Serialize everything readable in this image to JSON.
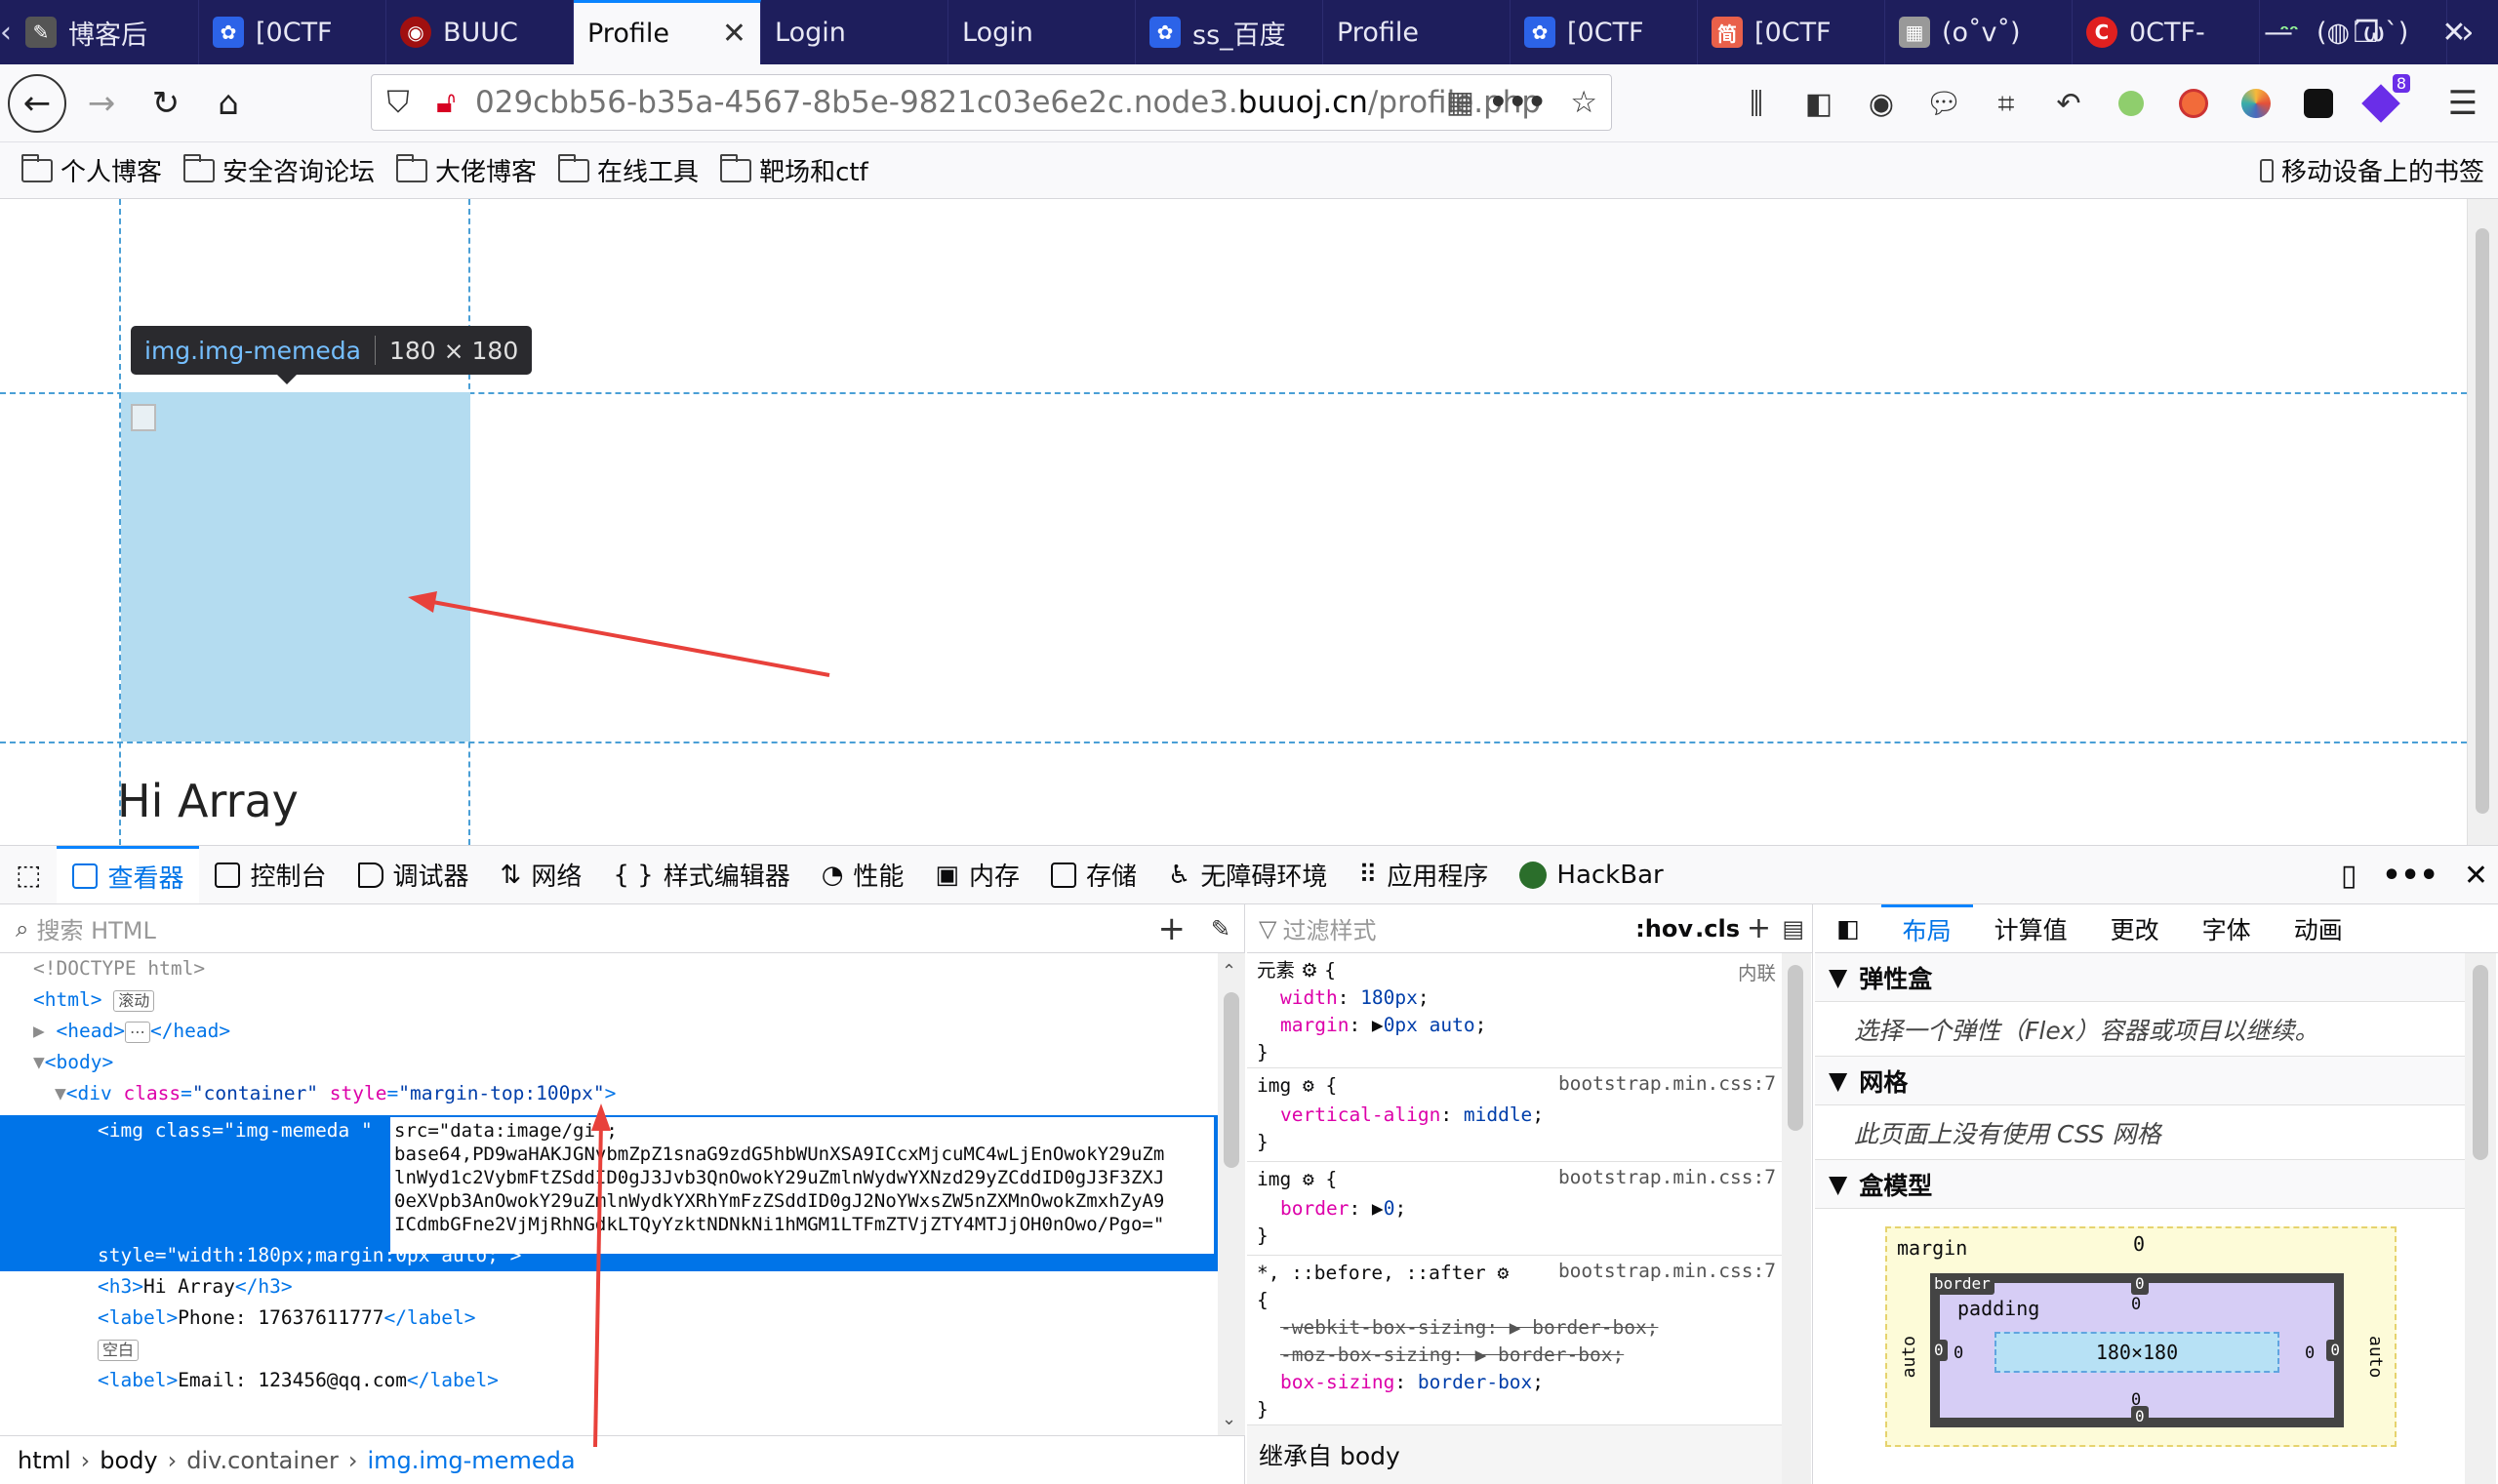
{
  "tabs": [
    {
      "title": "博客后",
      "icon": "blog-favicon"
    },
    {
      "title": "[0CTF",
      "icon": "baidu-paw-favicon"
    },
    {
      "title": "BUUC",
      "icon": "buuctf-favicon"
    },
    {
      "title": "Profile",
      "icon": "",
      "active": true
    },
    {
      "title": "Login",
      "icon": ""
    },
    {
      "title": "Login",
      "icon": ""
    },
    {
      "title": "ss_百度",
      "icon": "baidu-paw-favicon"
    },
    {
      "title": "Profile",
      "icon": ""
    },
    {
      "title": "[0CTF",
      "icon": "baidu-paw-favicon"
    },
    {
      "title": "[0CTF",
      "icon": "jianshu-favicon"
    },
    {
      "title": "(o˚v˚)",
      "icon": "kaomoji-favicon"
    },
    {
      "title": "0CTF-",
      "icon": "csdn-favicon"
    },
    {
      "title": "(◍´ω`)",
      "icon": "face-favicon"
    }
  ],
  "url": {
    "prefix": "029cbb56-b35a-4567-8b5e-9821c03e6e2c.node3.",
    "host": "buuoj.cn",
    "path": "/profile.php"
  },
  "bookmarks": [
    "个人博客",
    "安全咨询论坛",
    "大佬博客",
    "在线工具",
    "靶场和ctf"
  ],
  "mobile_bookmarks": "移动设备上的书签",
  "extension_badge": "8",
  "page": {
    "greeting": "Hi Array"
  },
  "highlighter": {
    "selector": "img.img-memeda",
    "size": "180 × 180"
  },
  "devtools": {
    "tabs": [
      "查看器",
      "控制台",
      "调试器",
      "网络",
      "样式编辑器",
      "性能",
      "内存",
      "存储",
      "无障碍环境",
      "应用程序",
      "HackBar"
    ],
    "search_placeholder": "搜索 HTML",
    "filter_placeholder": "过滤样式",
    "hov": ":hov",
    "cls": ".cls",
    "markup": {
      "doctype": "<!DOCTYPE html>",
      "html_badge": "滚动",
      "before": "::before",
      "img_class": "img-memeda ",
      "img_src": "src=\"data:image/gif;\nbase64,PD9waHAKJGNvbmZpZ1snaG9zdG5hbWUnXSA9ICcxMjcuMC4wLjEnOwokY29uZm\nlnWyd1c2VybmFtZSddID0gJ3Jvb3QnOwokY29uZmlnWydwYXNzd29yZCddID0gJ3F3ZXJ\n0eXVpb3AnOwokY29uZmlnWydkYXRhYmFzZSddID0gJ2NoYWxsZW5nZXMnOwokZmxhZyA9\nICdmbGFne2VjMjRhNGdkLTQyYzktNDNkNi1hMGM1LTFmZTVjZTY4MTJjOH0nOwo/Pgo=\"",
      "img_style": "width:180px;margin:0px auto;",
      "h3_text": "Hi Array",
      "phone": "Phone: 17637611777",
      "empty_badge": "空白",
      "email": "Email: 123456@qq.com"
    },
    "breadcrumbs": [
      "html",
      "body",
      "div.container",
      "img.img-memeda"
    ],
    "rules": {
      "element_label": "元素",
      "inline_label": "内联",
      "source": "bootstrap.min.css:7",
      "inherit_label": "继承自 body"
    },
    "layout": {
      "tabs": [
        "布局",
        "计算值",
        "更改",
        "字体",
        "动画"
      ],
      "flex_title": "弹性盒",
      "flex_msg": "选择一个弹性（Flex）容器或项目以继续。",
      "grid_title": "网格",
      "grid_msg": "此页面上没有使用 CSS 网格",
      "boxmodel_title": "盒模型",
      "box": {
        "margin_label": "margin",
        "border_label": "border",
        "padding_label": "padding",
        "content": "180×180",
        "auto": "auto",
        "zero": "0"
      }
    }
  },
  "colors": {
    "accent": "#0a84ff",
    "tab_strip": "#1e1e5c",
    "highlight": "#b4dcf0",
    "selection": "#0074e8",
    "arrow": "#e8413b"
  }
}
